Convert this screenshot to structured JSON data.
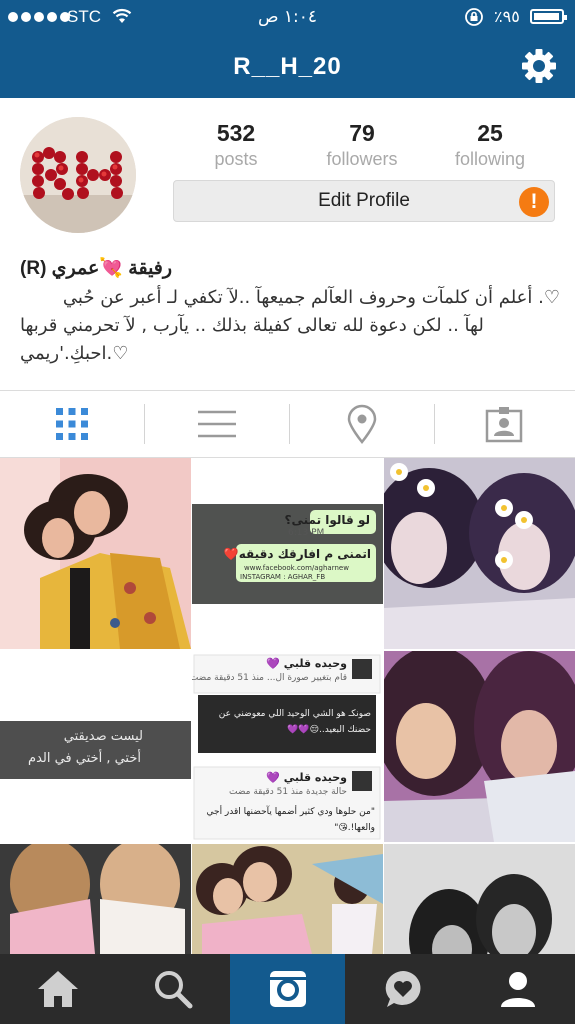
{
  "status_bar": {
    "carrier": "STC",
    "time": "١:٠٤ ص",
    "battery_percent": "٪٩٥",
    "battery_level": 0.95,
    "icons": [
      "signal-dots-icon",
      "wifi-icon",
      "orientation-lock-icon",
      "battery-icon"
    ]
  },
  "header": {
    "title": "R__H_20",
    "settings_icon": "gear-icon"
  },
  "profile": {
    "stats": [
      {
        "value": "532",
        "label": "posts"
      },
      {
        "value": "79",
        "label": "followers"
      },
      {
        "value": "25",
        "label": "following"
      }
    ],
    "edit_button_label": "Edit Profile",
    "alert_symbol": "!",
    "display_name": "رفيقة 💘عمري (R)",
    "bio_lines": [
      "♡. أعلم أن كلمآت وحروف العآلم جميعهآ ..لآ تكفي لـ أعبر عن حُبي",
      "لهآ .. لكن دعوة لله تعالى كفيلة بذلك .. يآرب , لآ تحرمني قربها",
      "♡.احبكِ.'ريمي"
    ]
  },
  "view_tabs": [
    {
      "name": "grid-view",
      "icon": "grid-icon",
      "active": true
    },
    {
      "name": "list-view",
      "icon": "list-icon",
      "active": false
    },
    {
      "name": "location-view",
      "icon": "location-pin-icon",
      "active": false
    },
    {
      "name": "tagged-view",
      "icon": "tagged-person-icon",
      "active": false
    }
  ],
  "posts": {
    "post2": {
      "question": "لو قالوا تمنى؟",
      "answer": "اتمنى م افارقك دقيقه❤️",
      "time": "6:13 PM",
      "watermark": "www.facebook.com/agharnew",
      "credit": "INSTAGRAM : AGHAR_FB"
    },
    "post4": {
      "line1": "ليست صديقتي",
      "line2": "أختي , أختي في الدم"
    },
    "post5": {
      "user": "وحيده قلبي 💜",
      "action": "قام بتغيير صورة ال... منذ 51 دقيقة مضت",
      "comment_line1": "صونكـ هو الشي الوحيد اللي معوضني عن",
      "comment_line2": "حضنك البعيد..😔💜💜"
    },
    "post5b": {
      "user": "وحيده قلبي 💜",
      "meta": "حالة جديدة منذ 51 دقيقة مضت",
      "quote_line1": "\"من حلوها ودي كثير أضمها يآحضنها اقدر أجي",
      "quote_line2": "والعها!.😘\""
    }
  },
  "bottom_tabs": [
    {
      "name": "home",
      "icon": "home-icon",
      "active": false
    },
    {
      "name": "search",
      "icon": "search-icon",
      "active": false
    },
    {
      "name": "camera",
      "icon": "camera-icon",
      "active": true
    },
    {
      "name": "activity",
      "icon": "activity-heart-icon",
      "active": false
    },
    {
      "name": "profile",
      "icon": "profile-icon",
      "active": false
    }
  ],
  "colors": {
    "nav_blue": "#135a8e",
    "tab_bar": "#2b2b2b",
    "active_tab": "#135a8e",
    "grid_icon_active": "#3b8ad8",
    "alert_orange": "#f57b12"
  }
}
